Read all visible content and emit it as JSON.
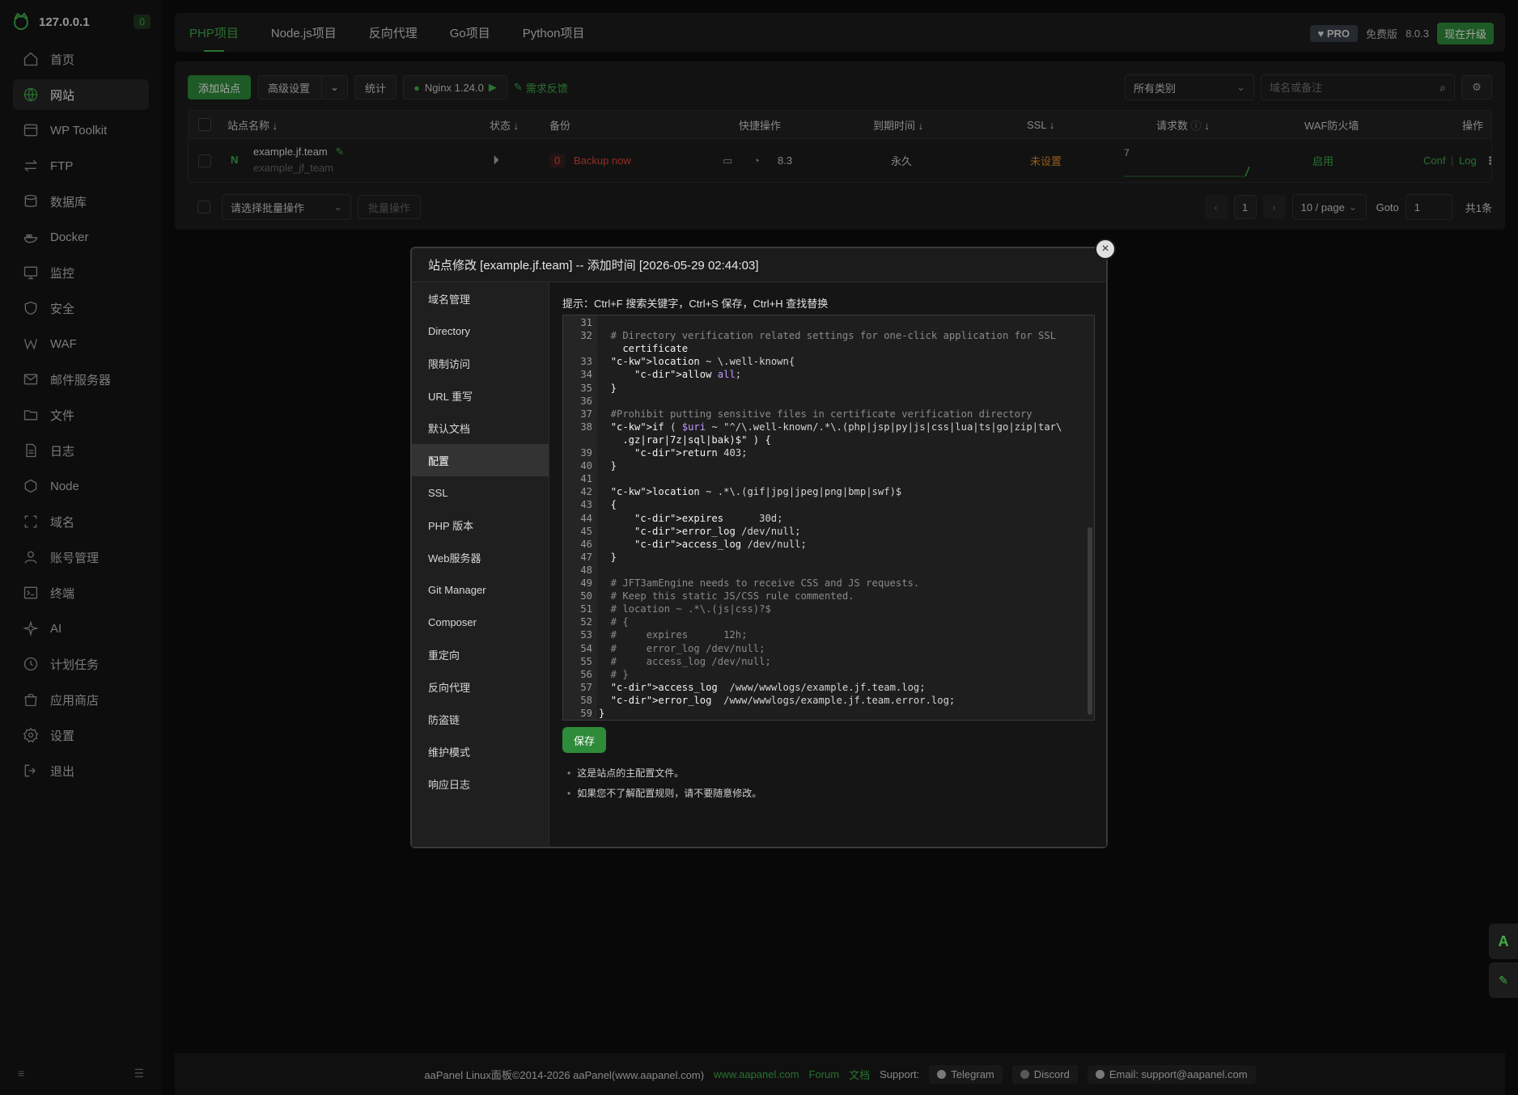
{
  "sidebar": {
    "ip": "127.0.0.1",
    "badge": "0",
    "items": [
      {
        "label": "首页",
        "icon": "home-icon"
      },
      {
        "label": "网站",
        "icon": "globe-icon"
      },
      {
        "label": "WP Toolkit",
        "icon": "wp-icon"
      },
      {
        "label": "FTP",
        "icon": "transfer-icon"
      },
      {
        "label": "数据库",
        "icon": "database-icon"
      },
      {
        "label": "Docker",
        "icon": "docker-icon"
      },
      {
        "label": "监控",
        "icon": "monitor-icon"
      },
      {
        "label": "安全",
        "icon": "shield-icon"
      },
      {
        "label": "WAF",
        "icon": "waf-icon"
      },
      {
        "label": "邮件服务器",
        "icon": "mail-icon"
      },
      {
        "label": "文件",
        "icon": "folder-icon"
      },
      {
        "label": "日志",
        "icon": "log-icon"
      },
      {
        "label": "Node",
        "icon": "node-icon"
      },
      {
        "label": "域名",
        "icon": "domain-icon"
      },
      {
        "label": "账号管理",
        "icon": "user-icon"
      },
      {
        "label": "终端",
        "icon": "terminal-icon"
      },
      {
        "label": "AI",
        "icon": "ai-icon"
      },
      {
        "label": "计划任务",
        "icon": "clock-icon"
      },
      {
        "label": "应用商店",
        "icon": "store-icon"
      },
      {
        "label": "设置",
        "icon": "gear-icon"
      },
      {
        "label": "退出",
        "icon": "logout-icon"
      }
    ]
  },
  "tabs": [
    "PHP项目",
    "Node.js项目",
    "反向代理",
    "Go项目",
    "Python项目"
  ],
  "topRight": {
    "pro": "PRO",
    "edition": "免费版",
    "version": "8.0.3",
    "upgrade": "现在升级"
  },
  "toolbar": {
    "add": "添加站点",
    "advanced": "高级设置",
    "stats": "统计",
    "nginx": "Nginx 1.24.0",
    "feedback": "需求反馈",
    "category": "所有类别",
    "searchPlaceholder": "域名或备注"
  },
  "table": {
    "headers": {
      "name": "站点名称",
      "status": "状态",
      "backup": "备份",
      "quick": "快捷操作",
      "expire": "到期时间",
      "ssl": "SSL",
      "requests": "请求数",
      "waf": "WAF防火墙",
      "ops": "操作"
    },
    "row": {
      "domain": "example.jf.team",
      "remark": "example_jf_team",
      "backupCount": "0",
      "backupLink": "Backup now",
      "php": "8.3",
      "expire": "永久",
      "ssl": "未设置",
      "requests": "7",
      "waf": "启用",
      "conf": "Conf",
      "log": "Log",
      "sep": "|"
    }
  },
  "pager": {
    "batchPlaceholder": "请选择批量操作",
    "batchBtn": "批量操作",
    "page": "1",
    "perPage": "10 / page",
    "goto": "Goto",
    "gotoValue": "1",
    "total": "共1条"
  },
  "modal": {
    "title": "站点修改 [example.jf.team] -- 添加时间 [2026-05-29 02:44:03]",
    "menu": [
      "域名管理",
      "Directory",
      "限制访问",
      "URL 重写",
      "默认文档",
      "配置",
      "SSL",
      "PHP 版本",
      "Web服务器",
      "Git Manager",
      "Composer",
      "重定向",
      "反向代理",
      "防盗链",
      "维护模式",
      "响应日志"
    ],
    "hint": "提示：Ctrl+F 搜索关键字，Ctrl+S 保存，Ctrl+H 查找替换",
    "save": "保存",
    "notes": [
      "这是站点的主配置文件。",
      "如果您不了解配置规则，请不要随意修改。"
    ],
    "code": [
      {
        "n": "31",
        "t": ""
      },
      {
        "n": "32",
        "t": "  # Directory verification related settings for one-click application for SSL"
      },
      {
        "n": "",
        "t": "    certificate"
      },
      {
        "n": "33",
        "t": "  location ~ \\.well-known{"
      },
      {
        "n": "34",
        "t": "      allow all;"
      },
      {
        "n": "35",
        "t": "  }"
      },
      {
        "n": "36",
        "t": ""
      },
      {
        "n": "37",
        "t": "  #Prohibit putting sensitive files in certificate verification directory"
      },
      {
        "n": "38",
        "t": "  if ( $uri ~ \"^/\\.well-known/.*\\.(php|jsp|py|js|css|lua|ts|go|zip|tar\\"
      },
      {
        "n": "",
        "t": "    .gz|rar|7z|sql|bak)$\" ) {"
      },
      {
        "n": "39",
        "t": "      return 403;"
      },
      {
        "n": "40",
        "t": "  }"
      },
      {
        "n": "41",
        "t": ""
      },
      {
        "n": "42",
        "t": "  location ~ .*\\.(gif|jpg|jpeg|png|bmp|swf)$"
      },
      {
        "n": "43",
        "t": "  {"
      },
      {
        "n": "44",
        "t": "      expires      30d;"
      },
      {
        "n": "45",
        "t": "      error_log /dev/null;"
      },
      {
        "n": "46",
        "t": "      access_log /dev/null;"
      },
      {
        "n": "47",
        "t": "  }"
      },
      {
        "n": "48",
        "t": ""
      },
      {
        "n": "49",
        "t": "  # JFT3amEngine needs to receive CSS and JS requests."
      },
      {
        "n": "50",
        "t": "  # Keep this static JS/CSS rule commented."
      },
      {
        "n": "51",
        "t": "  # location ~ .*\\.(js|css)?$"
      },
      {
        "n": "52",
        "t": "  # {"
      },
      {
        "n": "53",
        "t": "  #     expires      12h;"
      },
      {
        "n": "54",
        "t": "  #     error_log /dev/null;"
      },
      {
        "n": "55",
        "t": "  #     access_log /dev/null;"
      },
      {
        "n": "56",
        "t": "  # }"
      },
      {
        "n": "57",
        "t": "  access_log  /www/wwwlogs/example.jf.team.log;"
      },
      {
        "n": "58",
        "t": "  error_log  /www/wwwlogs/example.jf.team.error.log;"
      },
      {
        "n": "59",
        "t": "}"
      }
    ]
  },
  "footer": {
    "copyright": "aaPanel Linux面板©2014-2026 aaPanel(www.aapanel.com)",
    "site": "www.aapanel.com",
    "forum": "Forum",
    "docs": "文档",
    "support": "Support:",
    "telegram": "Telegram",
    "discord": "Discord",
    "email": "Email: support@aapanel.com"
  },
  "colors": {
    "accent": "#3fae4a",
    "danger": "#e0463a",
    "warning": "#e08a2a"
  }
}
